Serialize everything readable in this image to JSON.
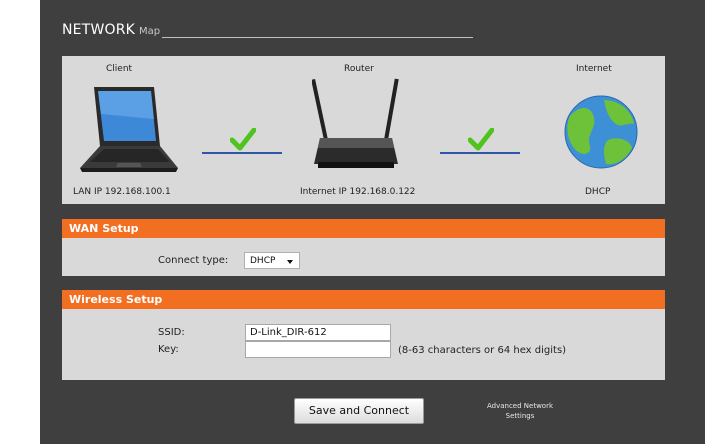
{
  "header": {
    "title": "NETWORK",
    "subtitle": "Map"
  },
  "map": {
    "client": {
      "label": "Client",
      "info": "LAN IP 192.168.100.1"
    },
    "router": {
      "label": "Router",
      "info": "Internet IP 192.168.0.122"
    },
    "internet": {
      "label": "Internet",
      "info": "DHCP"
    },
    "link_color": "#2d56a6",
    "check_color": "#4fc31e"
  },
  "wan": {
    "title": "WAN Setup",
    "connect_type_label": "Connect type:",
    "connect_type_value": "DHCP"
  },
  "wireless": {
    "title": "Wireless Setup",
    "ssid_label": "SSID:",
    "ssid_value": "D-Link_DIR-612",
    "key_label": "Key:",
    "key_value": "",
    "key_hint": "(8-63 characters or 64 hex digits)"
  },
  "actions": {
    "save_label": "Save and Connect",
    "advanced_line1": "Advanced Network",
    "advanced_line2": "Settings"
  },
  "colors": {
    "accent": "#f26f21",
    "background": "#3f3f3f",
    "panel": "#d9d9d9"
  }
}
